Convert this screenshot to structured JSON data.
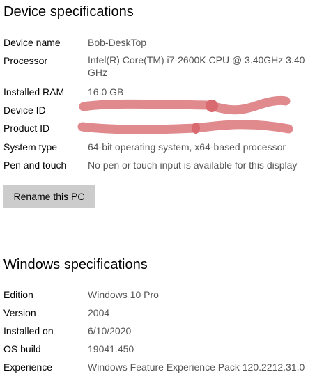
{
  "device_specs": {
    "heading": "Device specifications",
    "rows": [
      {
        "label": "Device name",
        "value": "Bob-DeskTop"
      },
      {
        "label": "Processor",
        "value": "Intel(R) Core(TM) i7-2600K CPU @ 3.40GHz   3.40 GHz"
      },
      {
        "label": "Installed RAM",
        "value": "16.0 GB"
      },
      {
        "label": "Device ID",
        "value": ""
      },
      {
        "label": "Product ID",
        "value": ""
      },
      {
        "label": "System type",
        "value": "64-bit operating system, x64-based processor"
      },
      {
        "label": "Pen and touch",
        "value": "No pen or touch input is available for this display"
      }
    ],
    "rename_button": "Rename this PC"
  },
  "windows_specs": {
    "heading": "Windows specifications",
    "rows": [
      {
        "label": "Edition",
        "value": "Windows 10 Pro"
      },
      {
        "label": "Version",
        "value": "2004"
      },
      {
        "label": "Installed on",
        "value": "6/10/2020"
      },
      {
        "label": "OS build",
        "value": "19041.450"
      },
      {
        "label": "Experience",
        "value": "Windows Feature Experience Pack 120.2212.31.0"
      }
    ]
  },
  "colors": {
    "redaction": "#e08a8e",
    "value_text": "#555555",
    "button_bg": "#cccccc"
  }
}
